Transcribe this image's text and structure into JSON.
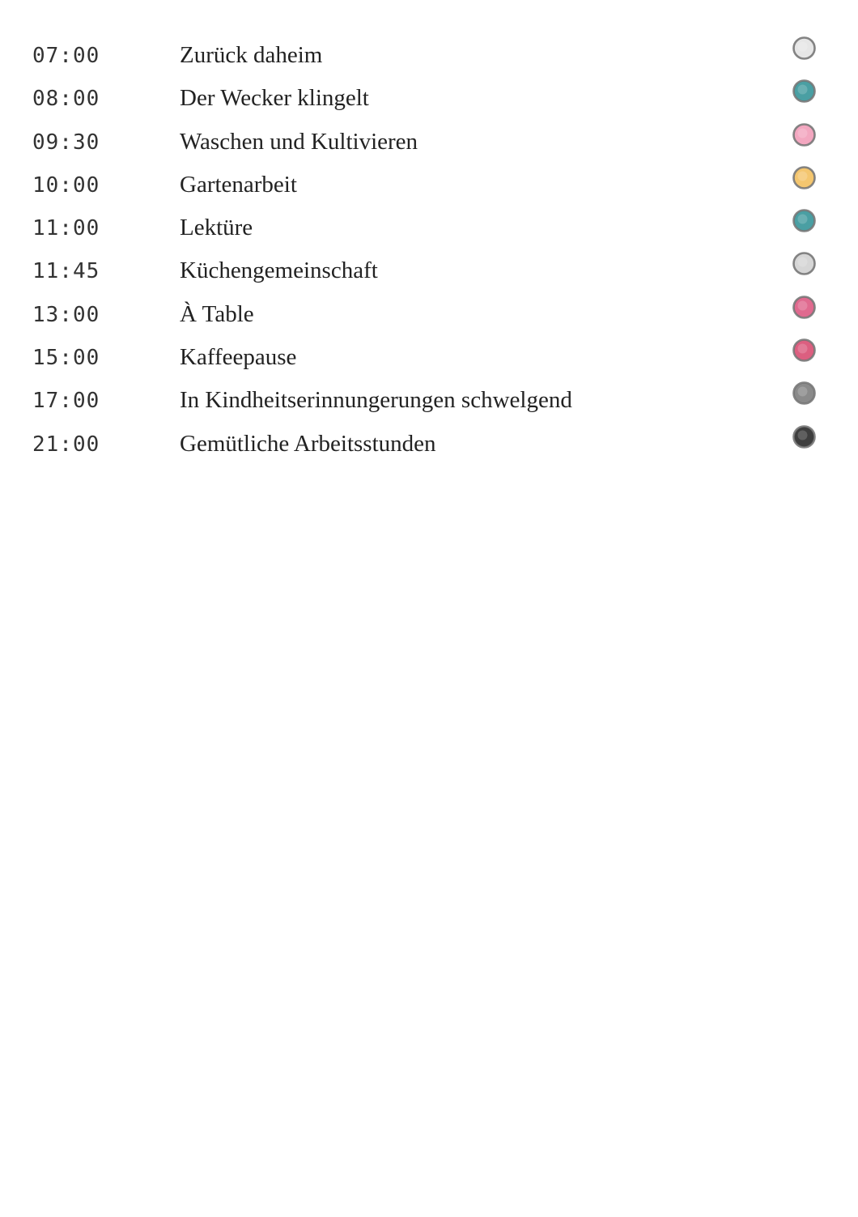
{
  "schedule": {
    "items": [
      {
        "time": "07:00",
        "label": "Zurück daheim",
        "dot_color": "#e6e6e6",
        "dot_icon": "marker-dot-icon"
      },
      {
        "time": "08:00",
        "label": "Der Wecker klingelt",
        "dot_color": "#4a9fa3",
        "dot_icon": "marker-dot-icon"
      },
      {
        "time": "09:30",
        "label": "Waschen und Kultivieren",
        "dot_color": "#f3a7c0",
        "dot_icon": "marker-dot-icon"
      },
      {
        "time": "10:00",
        "label": "Gartenarbeit",
        "dot_color": "#f4c66f",
        "dot_icon": "marker-dot-icon"
      },
      {
        "time": "11:00",
        "label": "Lektüre",
        "dot_color": "#4a9fa3",
        "dot_icon": "marker-dot-icon"
      },
      {
        "time": "11:45",
        "label": "Küchengemeinschaft",
        "dot_color": "#d6d6d6",
        "dot_icon": "marker-dot-icon"
      },
      {
        "time": "13:00",
        "label": "À Table",
        "dot_color": "#e06a8f",
        "dot_icon": "marker-dot-icon"
      },
      {
        "time": "15:00",
        "label": "Kaffeepause",
        "dot_color": "#dc5f80",
        "dot_icon": "marker-dot-icon"
      },
      {
        "time": "17:00",
        "label": "In Kindheitserinnungerungen schwelgend",
        "dot_color": "#8a8a8a",
        "dot_icon": "marker-dot-icon"
      },
      {
        "time": "21:00",
        "label": "Gemütliche Arbeitsstunden",
        "dot_color": "#3e3e3e",
        "dot_icon": "marker-dot-icon"
      }
    ]
  }
}
